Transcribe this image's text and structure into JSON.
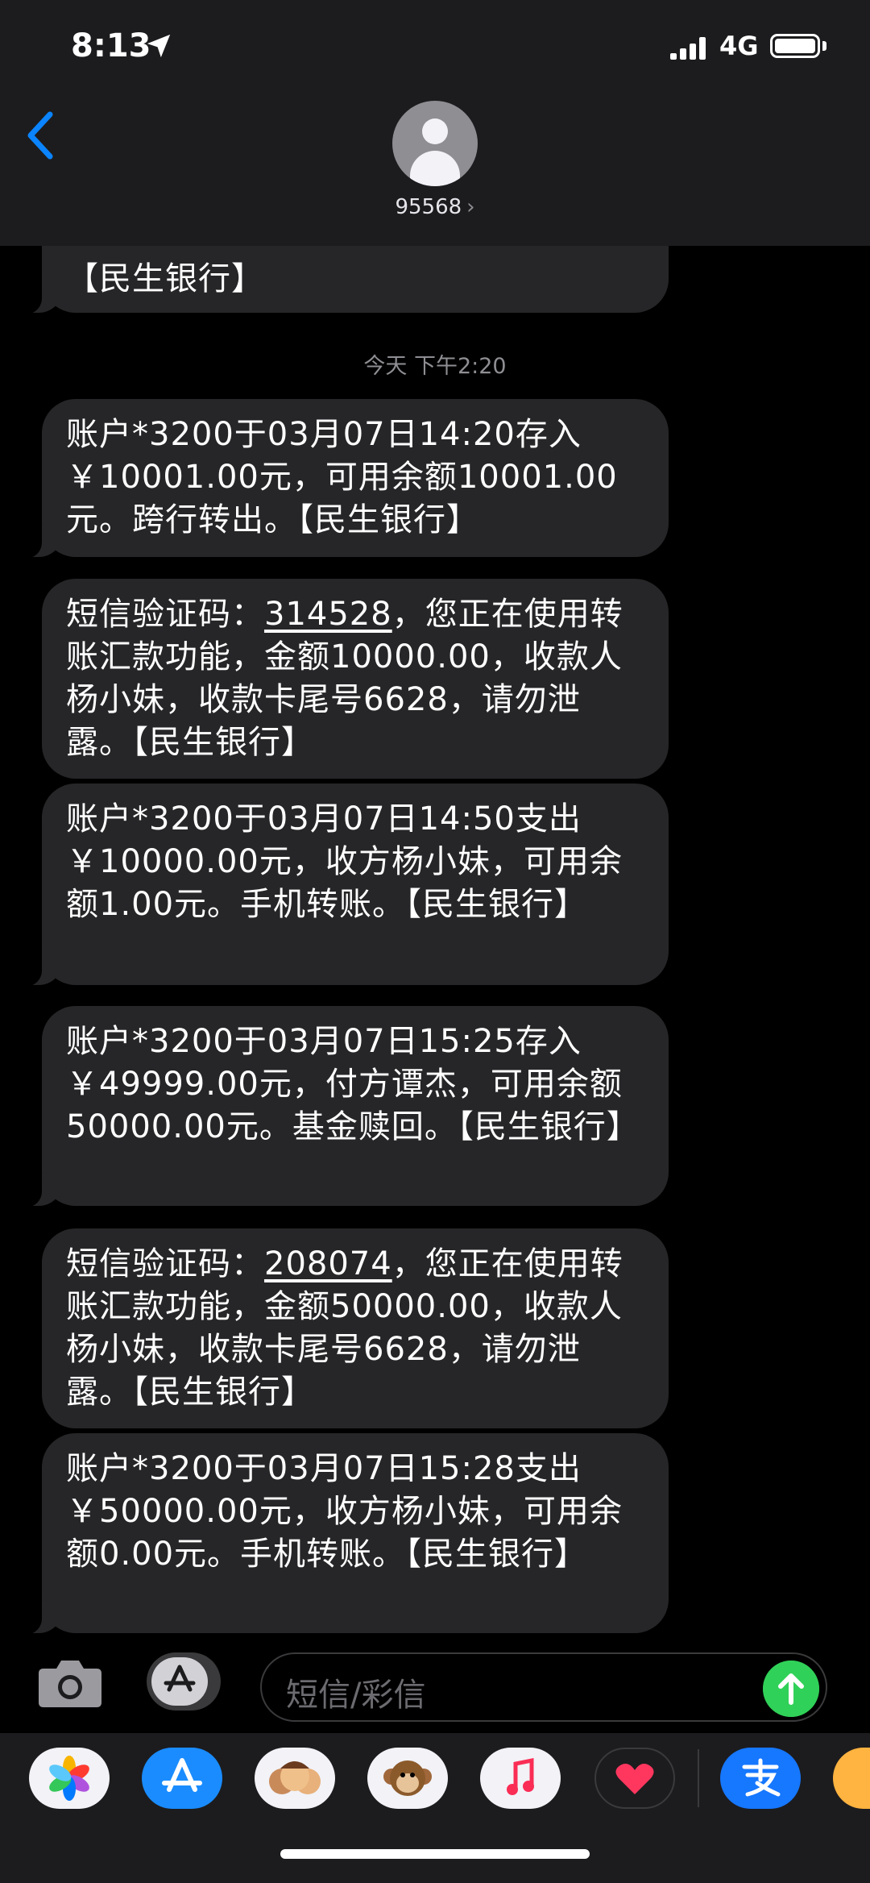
{
  "status_bar": {
    "time": "8:13",
    "network": "4G"
  },
  "header": {
    "contact": "95568",
    "chevron": "›"
  },
  "messages": [
    {
      "text": "【民生银行】"
    },
    {
      "text": "账户*3200于03月07日14:20存入￥10001.00元，可用余额10001.00元。跨行转出。【民生银行】"
    },
    {
      "pre": "短信验证码：",
      "code": "314528",
      "post": "，您正在使用转账汇款功能，金额10000.00，收款人杨小妹，收款卡尾号6628，请勿泄露。【民生银行】"
    },
    {
      "text": "账户*3200于03月07日14:50支出￥10000.00元，收方杨小妹，可用余额1.00元。手机转账。【民生银行】"
    },
    {
      "text": "账户*3200于03月07日15:25存入￥49999.00元，付方谭杰，可用余额50000.00元。基金赎回。【民生银行】"
    },
    {
      "pre": "短信验证码：",
      "code": "208074",
      "post": "，您正在使用转账汇款功能，金额50000.00，收款人杨小妹，收款卡尾号6628，请勿泄露。【民生银行】"
    },
    {
      "text": "账户*3200于03月07日15:28支出￥50000.00元，收方杨小妹，可用余额0.00元。手机转账。【民生银行】"
    }
  ],
  "timestamp": "今天 下午2:20",
  "composer": {
    "placeholder": "短信/彩信"
  },
  "apps": [
    "photos-icon",
    "appstore-icon",
    "memoji-icon",
    "monkey-animoji-icon",
    "music-icon",
    "heart-sticker-icon",
    "alipay-icon",
    "extra-app-icon"
  ],
  "colors": {
    "bubble": "#262628",
    "accent": "#0a84ff",
    "send": "#30d158"
  }
}
